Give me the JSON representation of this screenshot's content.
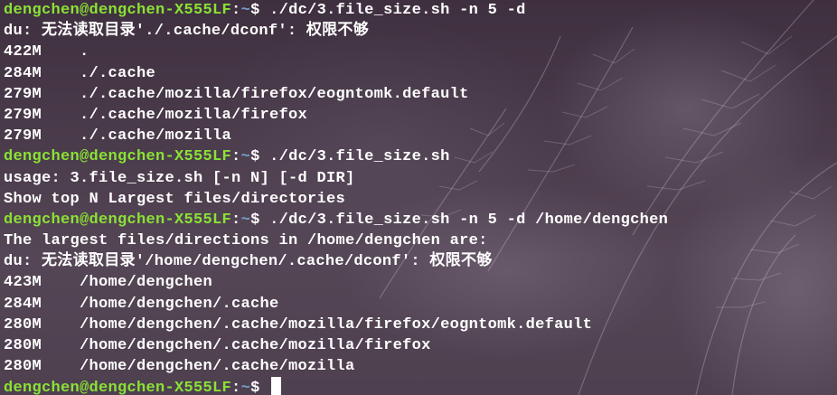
{
  "terminal": {
    "prompt": {
      "user_host": "dengchen@dengchen-X555LF",
      "colon": ":",
      "path": "~",
      "dollar": "$ "
    },
    "colors": {
      "user_host": "#8ae234",
      "path": "#729fcf",
      "text": "#ffffff",
      "background": "#4a3b4b"
    },
    "lines": [
      {
        "type": "prompt",
        "command": "./dc/3.file_size.sh -n 5 -d"
      },
      {
        "type": "output",
        "text": "du: 无法读取目录'./.cache/dconf': 权限不够"
      },
      {
        "type": "output",
        "text": "422M    ."
      },
      {
        "type": "output",
        "text": "284M    ./.cache"
      },
      {
        "type": "output",
        "text": "279M    ./.cache/mozilla/firefox/eogntomk.default"
      },
      {
        "type": "output",
        "text": "279M    ./.cache/mozilla/firefox"
      },
      {
        "type": "output",
        "text": "279M    ./.cache/mozilla"
      },
      {
        "type": "prompt",
        "command": "./dc/3.file_size.sh"
      },
      {
        "type": "output",
        "text": "usage: 3.file_size.sh [-n N] [-d DIR]"
      },
      {
        "type": "output",
        "text": "Show top N Largest files/directories"
      },
      {
        "type": "prompt",
        "command": "./dc/3.file_size.sh -n 5 -d /home/dengchen"
      },
      {
        "type": "output",
        "text": "The largest files/directions in /home/dengchen are:"
      },
      {
        "type": "output",
        "text": "du: 无法读取目录'/home/dengchen/.cache/dconf': 权限不够"
      },
      {
        "type": "output",
        "text": "423M    /home/dengchen"
      },
      {
        "type": "output",
        "text": "284M    /home/dengchen/.cache"
      },
      {
        "type": "output",
        "text": "280M    /home/dengchen/.cache/mozilla/firefox/eogntomk.default"
      },
      {
        "type": "output",
        "text": "280M    /home/dengchen/.cache/mozilla/firefox"
      },
      {
        "type": "output",
        "text": "280M    /home/dengchen/.cache/mozilla"
      },
      {
        "type": "prompt",
        "command": ""
      }
    ]
  }
}
